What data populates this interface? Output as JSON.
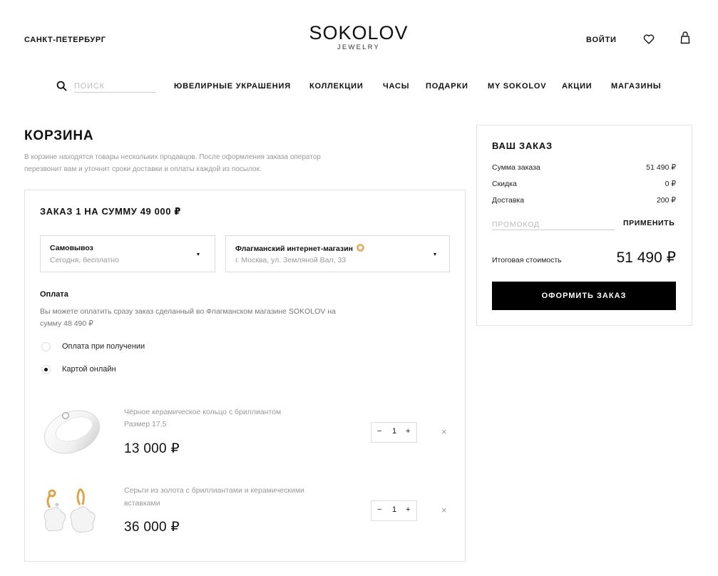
{
  "header": {
    "city": "САНКТ-ПЕТЕРБУРГ",
    "logo_main": "SOKOLOV",
    "logo_sub": "JEWELRY",
    "login": "ВОЙТИ",
    "icons": [
      "heart-icon",
      "bag-icon"
    ]
  },
  "nav": {
    "search_placeholder": "ПОИСК",
    "items": [
      "ЮВЕЛИРНЫЕ УКРАШЕНИЯ",
      "КОЛЛЕКЦИИ",
      "ЧАСЫ",
      "ПОДАРКИ",
      "MY SOKOLOV",
      "АКЦИИ",
      "МАГАЗИНЫ"
    ]
  },
  "cart": {
    "title": "КОРЗИНА",
    "note": "В корзине находятся товары нескольких продавцов. После оформления заказа оператор перезвонит вам и уточнит сроки доставки и оплаты каждой из посылок."
  },
  "order": {
    "title": "ЗАКАЗ 1 НА СУММУ 49 000 ₽",
    "delivery": {
      "title": "Самовывоз",
      "sub": "Сегодня, бесплатно"
    },
    "store": {
      "title": "Флагманский интернет-магазин",
      "sub": "г. Москва, ул. Земляной Вал, 33"
    },
    "payment": {
      "title": "Оплата",
      "text": "Вы можете оплатить сразу заказ сделанный во Флагманском магазине SOKOLOV на сумму 48 490 ₽",
      "options": [
        {
          "label": "Оплата при получении",
          "selected": false
        },
        {
          "label": "Картой онлайн",
          "selected": true
        }
      ]
    },
    "items": [
      {
        "name": "Чёрное керамическое кольцо с бриллиантом",
        "size": "Размер 17,5",
        "price": "13 000 ₽",
        "qty": "1"
      },
      {
        "name": "Серьги из золота с бриллиантами и керамическими вставками",
        "size": "",
        "price": "36 000 ₽",
        "qty": "1"
      }
    ],
    "qty_minus": "−",
    "qty_plus": "+",
    "remove": "×"
  },
  "summary": {
    "title": "ВАШ ЗАКАЗ",
    "rows": [
      {
        "label": "Сумма заказа",
        "value": "51 490 ₽"
      },
      {
        "label": "Скидка",
        "value": "0 ₽"
      },
      {
        "label": "Доставка",
        "value": "200 ₽"
      }
    ],
    "promo_placeholder": "ПРОМОКОД",
    "apply": "ПРИМЕНИТЬ",
    "total_label": "Итоговая стоимость",
    "total_value": "51 490 ₽",
    "checkout": "ОФОРМИТЬ ЗАКАЗ"
  }
}
